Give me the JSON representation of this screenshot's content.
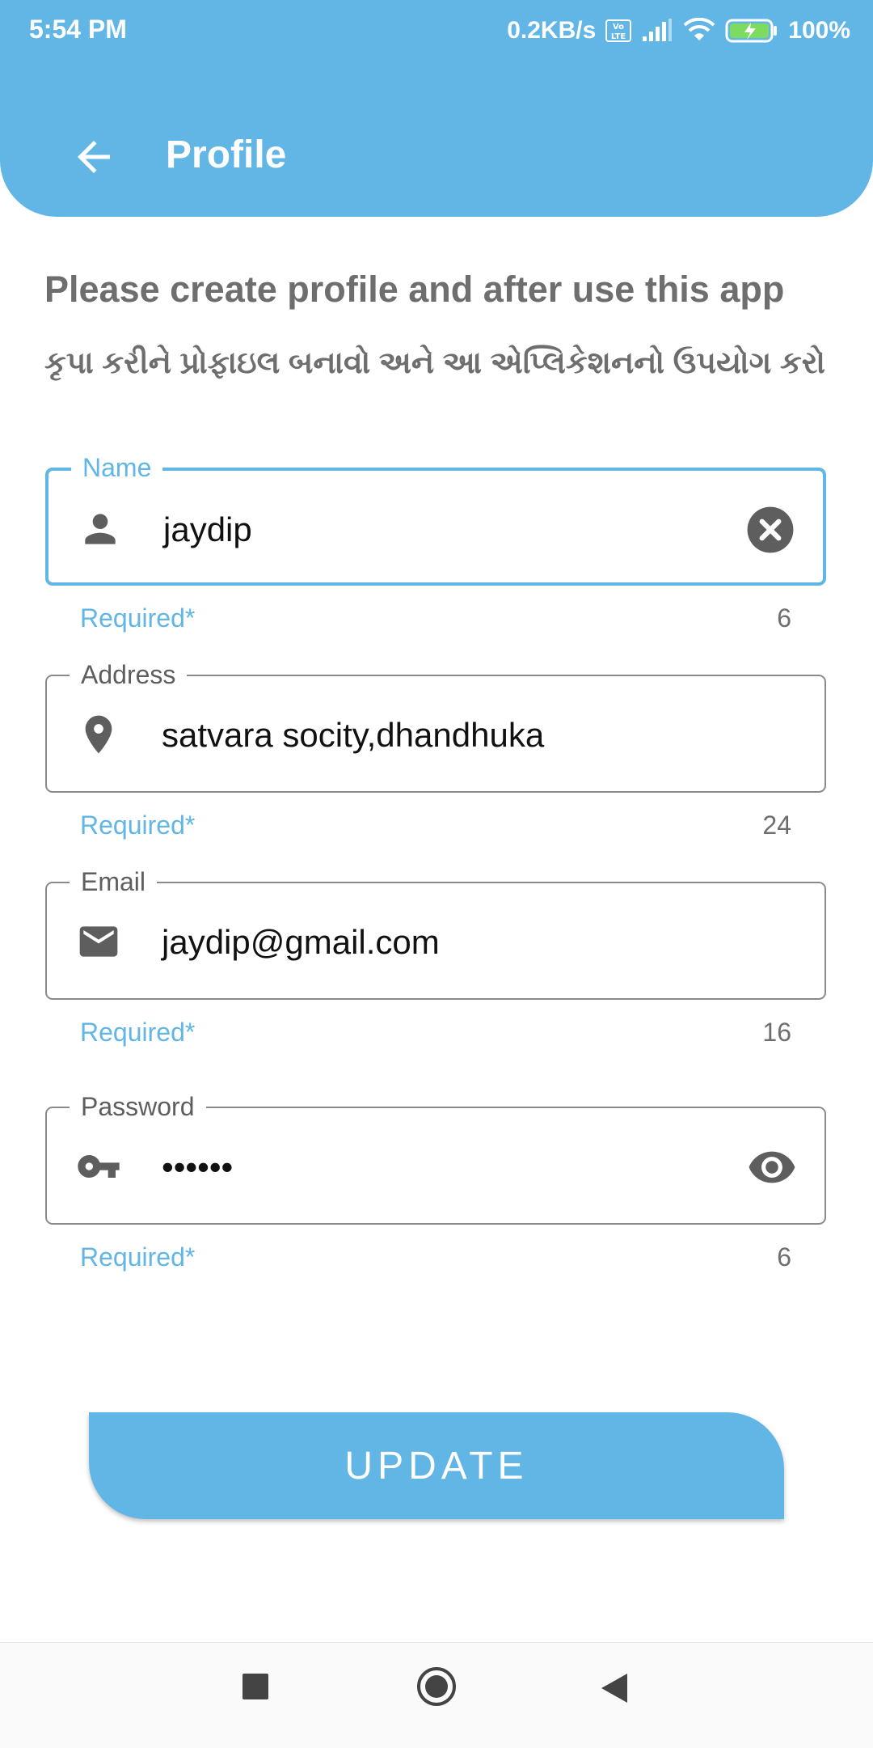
{
  "status_bar": {
    "time": "5:54 PM",
    "network_speed": "0.2KB/s",
    "volte": "Vo LTE",
    "battery": "100%"
  },
  "header": {
    "title": "Profile",
    "back_icon": "arrow-left-icon"
  },
  "intro": {
    "english": "Please create profile and after use this app",
    "gujarati": "કૃપા કરીને પ્રોફાઇલ બનાવો અને આ એપ્લિકેશનનો ઉપયોગ કરો"
  },
  "form": {
    "name": {
      "label": "Name",
      "value": "jaydip",
      "helper": "Required*",
      "counter": "6",
      "lead_icon": "person-icon",
      "trail_icon": "clear-icon"
    },
    "address": {
      "label": "Address",
      "value": "satvara socity,dhandhuka",
      "helper": "Required*",
      "counter": "24",
      "lead_icon": "location-pin-icon"
    },
    "email": {
      "label": "Email",
      "value": "jaydip@gmail.com",
      "helper": "Required*",
      "counter": "16",
      "lead_icon": "mail-icon"
    },
    "password": {
      "label": "Password",
      "value": "••••••",
      "helper": "Required*",
      "counter": "6",
      "lead_icon": "key-icon",
      "trail_icon": "eye-icon"
    }
  },
  "actions": {
    "update_label": "UPDATE"
  },
  "colors": {
    "accent": "#61b6e6",
    "text_secondary": "#6e6e6e"
  },
  "nav": {
    "icons": [
      "recents-square-icon",
      "home-circle-icon",
      "back-triangle-icon"
    ]
  }
}
